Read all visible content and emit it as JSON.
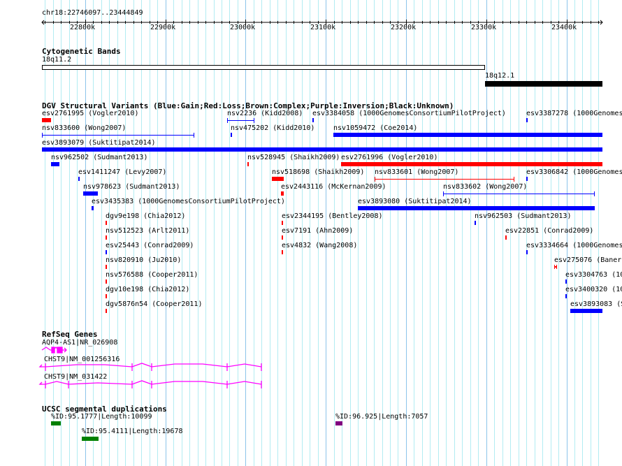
{
  "ruler": {
    "region": "chr18:22746097..23444849",
    "ticks": [
      "22800k",
      "22900k",
      "23000k",
      "23100k",
      "23200k",
      "23300k",
      "23400k"
    ]
  },
  "cyto": {
    "title": "Cytogenetic Bands",
    "bands": [
      {
        "label": "18q11.2"
      },
      {
        "label": "18q12.1"
      }
    ]
  },
  "dgv": {
    "title": "DGV Structural Variants (Blue:Gain;Red:Loss;Brown:Complex;Purple:Inversion;Black:Unknown)",
    "features": [
      {
        "label": "esv2761995 (Vogler2010)",
        "type": "Loss"
      },
      {
        "label": "nsv2236 (Kidd2008)",
        "type": "Gain"
      },
      {
        "label": "esv3384058 (1000GenomesConsortiumPilotProject)",
        "type": "Gain"
      },
      {
        "label": "esv3387278 (1000Genomes",
        "type": "Gain"
      },
      {
        "label": "nsv833600 (Wong2007)",
        "type": "Gain"
      },
      {
        "label": "nsv475202 (Kidd2010)",
        "type": "Gain"
      },
      {
        "label": "nsv1059472 (Coe2014)",
        "type": "Gain"
      },
      {
        "label": "esv3893079 (Suktitipat2014)",
        "type": "Gain"
      },
      {
        "label": "nsv962502 (Sudmant2013)",
        "type": "Gain"
      },
      {
        "label": "nsv528945 (Shaikh2009)",
        "type": "Loss"
      },
      {
        "label": "esv2761996 (Vogler2010)",
        "type": "Loss"
      },
      {
        "label": "esv1411247 (Levy2007)",
        "type": "Gain"
      },
      {
        "label": "nsv518698 (Shaikh2009)",
        "type": "Loss"
      },
      {
        "label": "nsv833601 (Wong2007)",
        "type": "Loss"
      },
      {
        "label": "esv3306842 (1000Genomes",
        "type": "Gain"
      },
      {
        "label": "nsv978623 (Sudmant2013)",
        "type": "Gain"
      },
      {
        "label": "esv2443116 (McKernan2009)",
        "type": "Loss"
      },
      {
        "label": "nsv833602 (Wong2007)",
        "type": "Gain"
      },
      {
        "label": "esv3435383 (1000GenomesConsortiumPilotProject)",
        "type": "Gain"
      },
      {
        "label": "esv3893080 (Suktitipat2014)",
        "type": "Gain"
      },
      {
        "label": "dgv9e198 (Chia2012)",
        "type": "Loss"
      },
      {
        "label": "esv2344195 (Bentley2008)",
        "type": "Loss"
      },
      {
        "label": "nsv962503 (Sudmant2013)",
        "type": "Gain"
      },
      {
        "label": "nsv512523 (Arlt2011)",
        "type": "Loss"
      },
      {
        "label": "esv7191 (Ahn2009)",
        "type": "Loss"
      },
      {
        "label": "esv22851 (Conrad2009)",
        "type": "Loss"
      },
      {
        "label": "esv25443 (Conrad2009)",
        "type": "Gain"
      },
      {
        "label": "esv4832 (Wang2008)",
        "type": "Loss"
      },
      {
        "label": "esv3334664 (1000Genomes",
        "type": "Gain"
      },
      {
        "label": "nsv820910 (Ju2010)",
        "type": "Loss"
      },
      {
        "label": "esv275076 (Baner",
        "type": "Loss"
      },
      {
        "label": "nsv576588 (Cooper2011)",
        "type": "Loss"
      },
      {
        "label": "esv3304763 (10",
        "type": "Gain"
      },
      {
        "label": "dgv10e198 (Chia2012)",
        "type": "Loss"
      },
      {
        "label": "esv3400320 (10",
        "type": "Gain"
      },
      {
        "label": "dgv5876n54 (Cooper2011)",
        "type": "Loss"
      },
      {
        "label": "esv3893083 (S",
        "type": "Gain"
      }
    ]
  },
  "refseq": {
    "title": "RefSeq Genes",
    "genes": [
      {
        "label": "AQP4-AS1|NR_026908"
      },
      {
        "label": "CHST9|NM_001256316"
      },
      {
        "label": "CHST9|NM_031422"
      }
    ]
  },
  "segdup": {
    "title": "UCSC segmental duplications",
    "features": [
      {
        "label": "%ID:95.1777|Length:10099"
      },
      {
        "label": "%ID:95.4111|Length:19678"
      },
      {
        "label": "%ID:96.925|Length:7057"
      }
    ]
  },
  "colors": {
    "Gain": "#0000ff",
    "Loss": "#ff0000",
    "gene": "#ff00ff",
    "segdup": "#008000",
    "segdup_high": "#800080",
    "grid": "#b2ecf2"
  }
}
